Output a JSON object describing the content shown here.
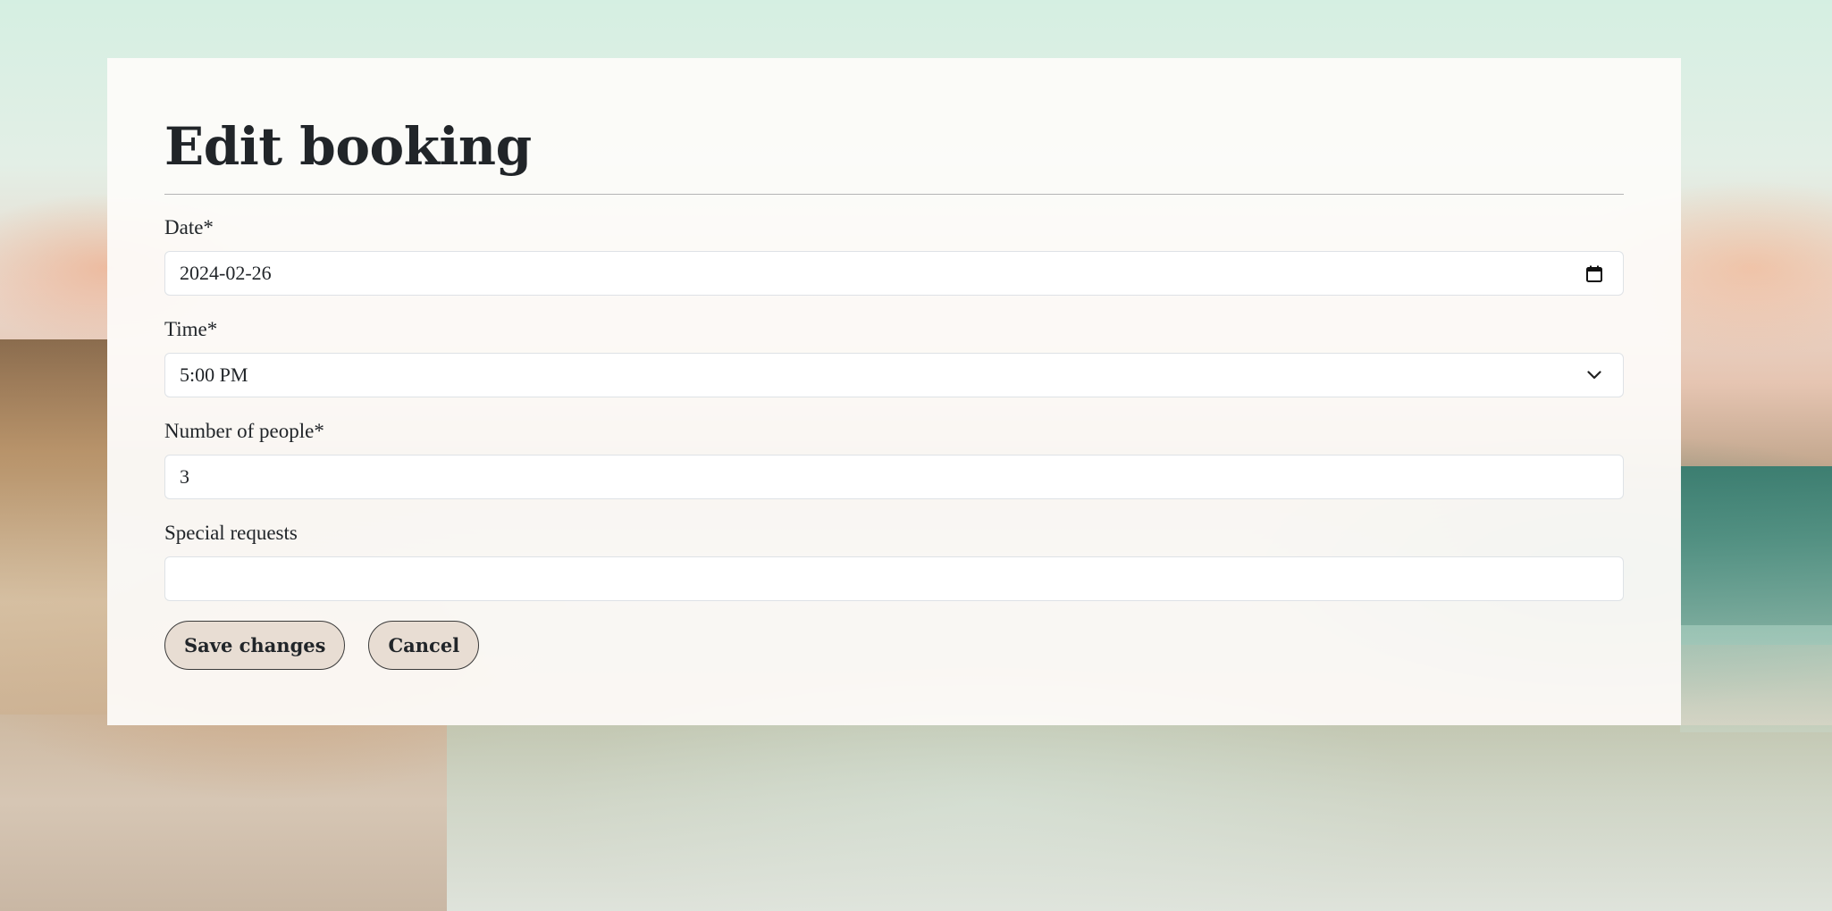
{
  "form": {
    "title": "Edit booking",
    "fields": {
      "date": {
        "label": "Date*",
        "value": "2024-02-26",
        "icon": "calendar-icon"
      },
      "time": {
        "label": "Time*",
        "value": "5:00 PM",
        "icon": "chevron-down-icon"
      },
      "people": {
        "label": "Number of people*",
        "value": "3"
      },
      "requests": {
        "label": "Special requests",
        "value": ""
      }
    },
    "buttons": {
      "save": "Save changes",
      "cancel": "Cancel"
    }
  },
  "colors": {
    "button_bg": "#e8ddd3",
    "text": "#212529",
    "card_bg": "#fdfcfa"
  }
}
